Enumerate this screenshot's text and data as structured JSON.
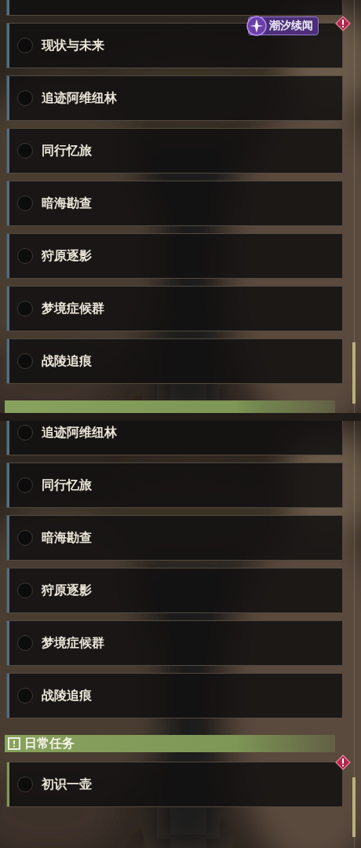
{
  "panels": [
    {
      "items": [
        {
          "kind": "stub",
          "color": "#4f6f86",
          "alert": false
        },
        {
          "kind": "quest",
          "title": "现状与未来",
          "color": "#4f6f86",
          "alert": true,
          "tag": "潮汐续闻"
        },
        {
          "kind": "quest",
          "title": "追迹阿维纽林",
          "color": "#4f6f86",
          "alert": false
        },
        {
          "kind": "quest",
          "title": "同行忆旅",
          "color": "#4f6f86",
          "alert": false
        },
        {
          "kind": "quest",
          "title": "暗海勘查",
          "color": "#4f6f86",
          "alert": false
        },
        {
          "kind": "quest",
          "title": "狩原逐影",
          "color": "#4f6f86",
          "alert": false
        },
        {
          "kind": "quest",
          "title": "梦境症候群",
          "color": "#4f6f86",
          "alert": false
        },
        {
          "kind": "quest",
          "title": "战陵追痕",
          "color": "#4f6f86",
          "alert": false
        },
        {
          "kind": "header",
          "cut": true
        }
      ]
    },
    {
      "items": [
        {
          "kind": "partial",
          "title": "追迹阿维纽林",
          "color": "#4f6f86",
          "alert": false
        },
        {
          "kind": "quest",
          "title": "同行忆旅",
          "color": "#4f6f86",
          "alert": false
        },
        {
          "kind": "quest",
          "title": "暗海勘查",
          "color": "#4f6f86",
          "alert": false
        },
        {
          "kind": "quest",
          "title": "狩原逐影",
          "color": "#4f6f86",
          "alert": false
        },
        {
          "kind": "quest",
          "title": "梦境症候群",
          "color": "#4f6f86",
          "alert": false
        },
        {
          "kind": "quest",
          "title": "战陵追痕",
          "color": "#4f6f86",
          "alert": false
        },
        {
          "kind": "header",
          "cut": false,
          "title": "日常任务"
        },
        {
          "kind": "quest",
          "title": "初识一壶",
          "color": "#7f9a58",
          "alert": true
        }
      ]
    }
  ]
}
